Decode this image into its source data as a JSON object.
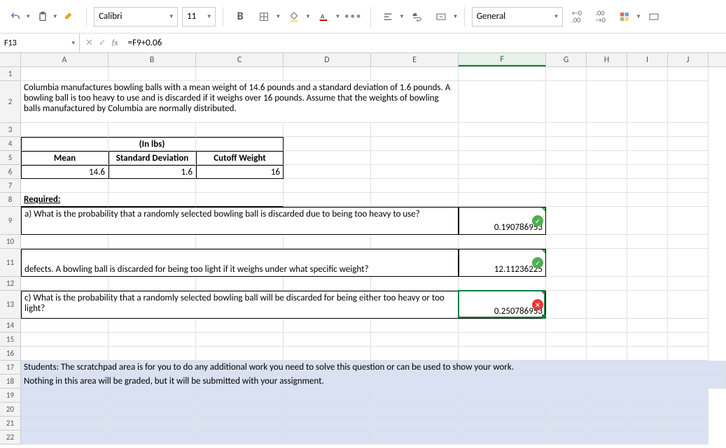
{
  "toolbar": {
    "font_name": "Calibri",
    "font_size": "11",
    "number_format": "General"
  },
  "formula_bar": {
    "name_box": "F13",
    "formula": "=F9+0.06"
  },
  "columns": [
    "A",
    "B",
    "C",
    "D",
    "E",
    "F",
    "G",
    "H",
    "I",
    "J"
  ],
  "rows": [
    "1",
    "2",
    "3",
    "4",
    "5",
    "6",
    "7",
    "8",
    "9",
    "10",
    "11",
    "12",
    "13",
    "14",
    "15",
    "16",
    "17",
    "18",
    "19",
    "20",
    "21",
    "22"
  ],
  "content": {
    "r2_text": "Columbia manufactures bowling balls with a mean weight of 14.6 pounds and a standard deviation of 1.6 pounds. A bowling ball is too heavy to use and is discarded if it weighs over 16 pounds. Assume that the weights of bowling balls manufactured by Columbia are normally distributed.",
    "r4_header": "(In lbs)",
    "r5_mean": "Mean",
    "r5_sd": "Standard Deviation",
    "r5_cutoff": "Cutoff Weight",
    "r6_mean": "14.6",
    "r6_sd": "1.6",
    "r6_cutoff": "16",
    "r8_required": "Required:",
    "r9_q": "a) What is the probability that a randomly selected bowling ball is discarded due to being too heavy to use?",
    "r9_ans": "0.190786953",
    "r11_q": "defects. A bowling ball is discarded for being too light if it weighs under what specific weight?",
    "r11_ans": "12.11236225",
    "r13_q": "c) What is the probability that a randomly selected bowling ball will be discarded for being either too heavy or too light?",
    "r13_ans": "0.250786953",
    "r17_text": "Students: The scratchpad area is for you to do any additional work you need to solve this question or can be used to show your work.",
    "r18_text": "Nothing in this area will be graded, but it will be submitted with your assignment."
  }
}
